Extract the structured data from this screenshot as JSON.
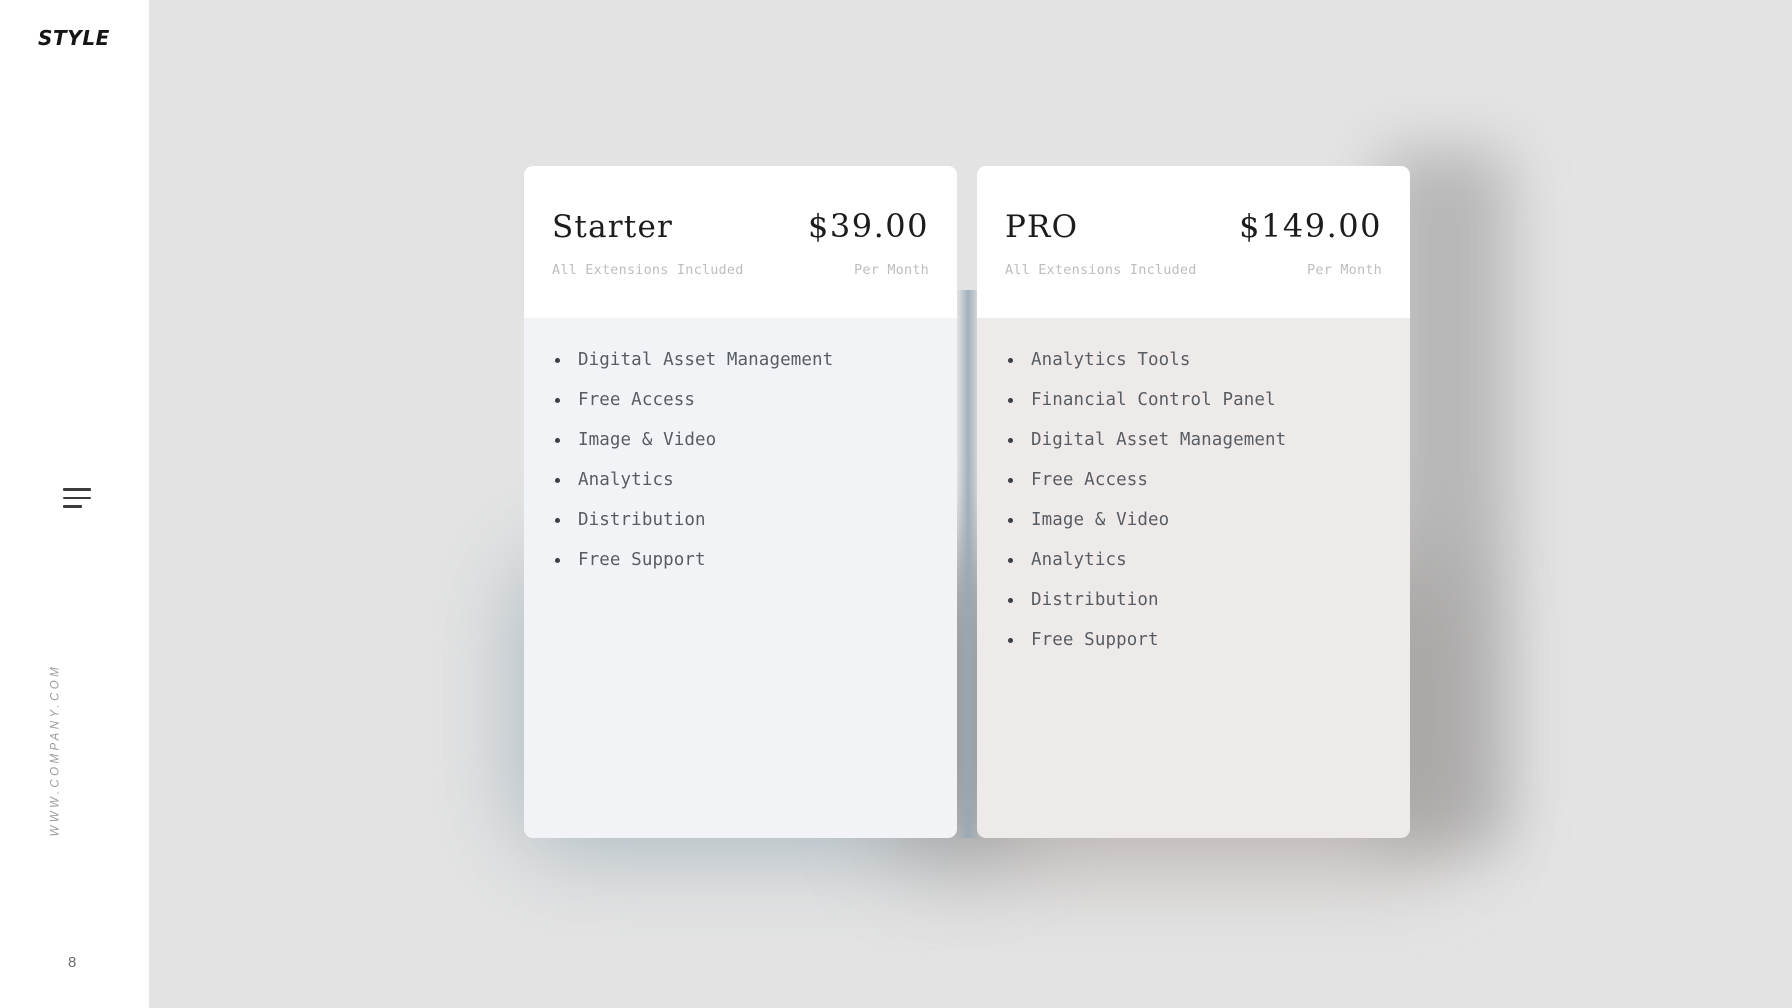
{
  "sidebar": {
    "logo": "STYLE",
    "menu_icon": "hamburger-menu-icon",
    "website_url": "WWW.COMPANY.COM",
    "page_number": "8"
  },
  "colors": {
    "page_background": "#ffffff",
    "canvas_background": "#e3e3e3",
    "card_header_background": "#ffffff",
    "starter_body_background": "#f1f3f7",
    "pro_body_background": "#efeaea",
    "heading_text": "#1c1c1c",
    "muted_text": "#bdbdbd",
    "feature_text": "#585d63",
    "bullet": "#3a3d42",
    "starter_shadow": "#7d95a4",
    "pro_shadow": "#8d8079"
  },
  "plans": [
    {
      "name": "Starter",
      "price": "$39.00",
      "subtitle": "All Extensions Included",
      "period": "Per Month",
      "features": [
        "Digital Asset Management",
        "Free Access",
        "Image & Video",
        "Analytics",
        "Distribution",
        "Free Support"
      ]
    },
    {
      "name": "PRO",
      "price": "$149.00",
      "subtitle": "All Extensions Included",
      "period": "Per Month",
      "features": [
        "Analytics Tools",
        "Financial Control Panel",
        "Digital Asset Management",
        "Free Access",
        "Image & Video",
        "Analytics",
        "Distribution",
        "Free Support"
      ]
    }
  ]
}
